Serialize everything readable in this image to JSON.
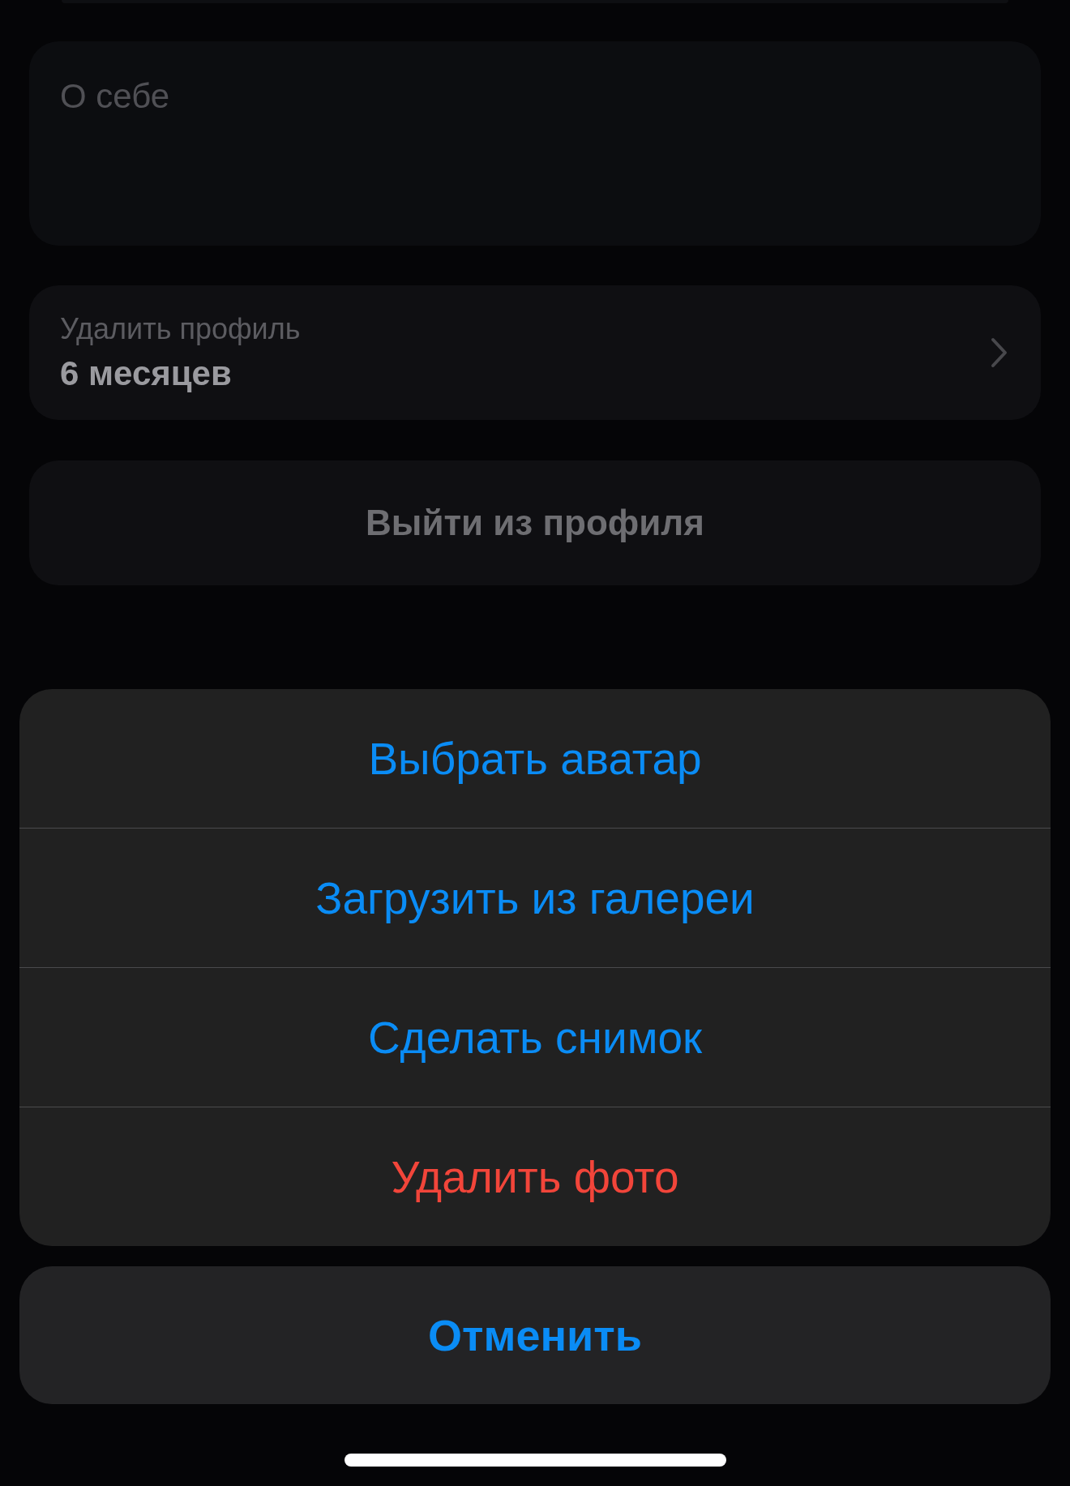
{
  "about": {
    "placeholder": "О себе"
  },
  "profile_deletion": {
    "label": "Удалить профиль",
    "value": "6 месяцев"
  },
  "logout": {
    "label": "Выйти из профиля"
  },
  "action_sheet": {
    "items": [
      {
        "label": "Выбрать аватар",
        "kind": "default"
      },
      {
        "label": "Загрузить из галереи",
        "kind": "default"
      },
      {
        "label": "Сделать снимок",
        "kind": "default"
      },
      {
        "label": "Удалить фото",
        "kind": "destructive"
      }
    ],
    "cancel": "Отменить"
  }
}
